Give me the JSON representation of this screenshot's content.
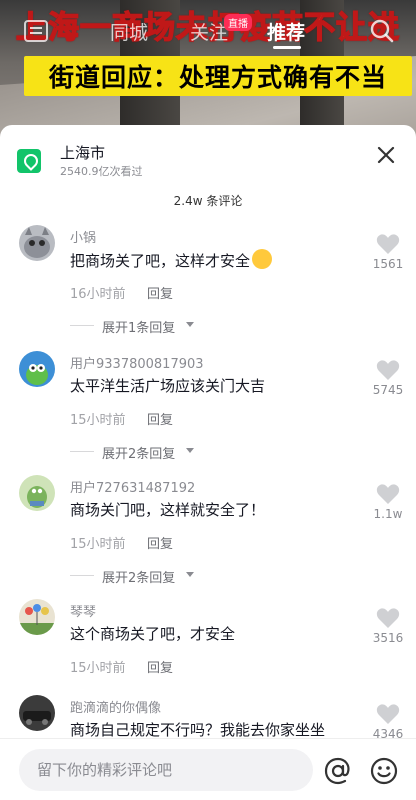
{
  "video": {
    "headline": "上海一商场未打疫苗不让进",
    "subtitle": "街道回应：处理方式确有不当"
  },
  "topnav": {
    "tabs": [
      {
        "label": "同城"
      },
      {
        "label": "关注"
      },
      {
        "label": "推荐"
      }
    ],
    "live_badge": "直播"
  },
  "location": {
    "name": "上海市",
    "views": "2540.9亿次看过"
  },
  "comments_header": "2.4w 条评论",
  "comments": [
    {
      "user": "小锅",
      "text": "把商场关了吧，这样才安全",
      "time": "16小时前",
      "reply": "回复",
      "expand": "展开1条回复",
      "likes": "1561"
    },
    {
      "user": "用户9337800817903",
      "text": "太平洋生活广场应该关门大吉",
      "time": "15小时前",
      "reply": "回复",
      "expand": "展开2条回复",
      "likes": "5745"
    },
    {
      "user": "用户727631487192",
      "text": "商场关门吧，这样就安全了！",
      "time": "15小时前",
      "reply": "回复",
      "expand": "展开2条回复",
      "likes": "1.1w"
    },
    {
      "user": "琴琴",
      "text": "这个商场关了吧，才安全",
      "time": "15小时前",
      "reply": "回复",
      "likes": "3516"
    },
    {
      "user": "跑滴滴的你偶像",
      "text": "商场自己规定不行吗？我能去你家坐坐",
      "likes": "4346"
    }
  ],
  "input": {
    "placeholder": "留下你的精彩评论吧"
  },
  "icons": {
    "location": "location-pin-icon",
    "close": "close-icon",
    "like": "heart-icon",
    "at": "at-mention-icon",
    "emoji": "emoji-icon",
    "search": "search-icon",
    "menu": "menu-icon"
  },
  "colors": {
    "accent": "#fe2c55",
    "location_green": "#12c46a",
    "headline_yellow": "#f4e21a"
  }
}
